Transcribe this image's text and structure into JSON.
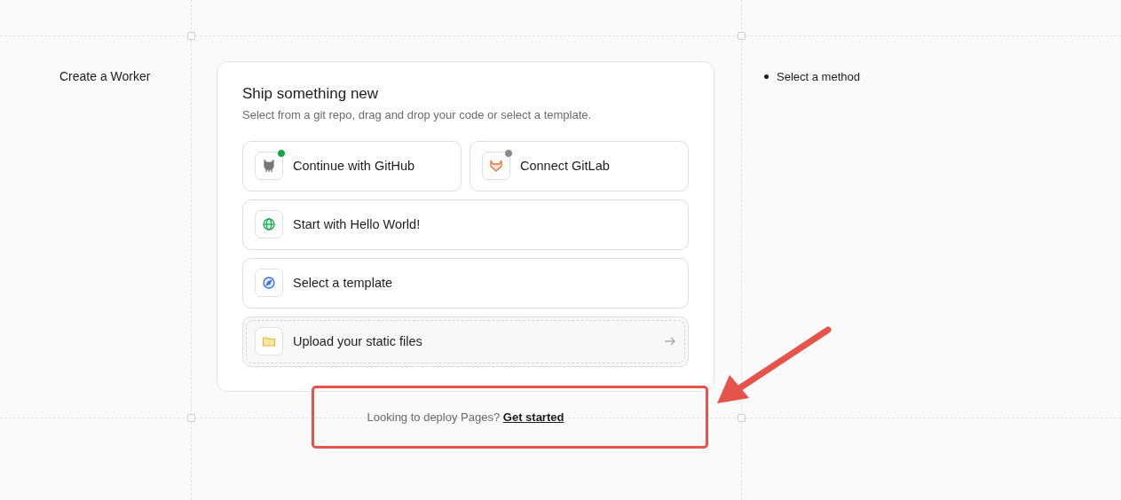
{
  "sidebar": {
    "title": "Create a Worker"
  },
  "card": {
    "title": "Ship something new",
    "subtitle": "Select from a git repo, drag and drop your code or select a template.",
    "options": [
      {
        "kind": "github",
        "label": "Continue with GitHub",
        "color": "#16a34a"
      },
      {
        "kind": "gitlab",
        "label": "Connect GitLab",
        "color": "#8a8a8a"
      },
      {
        "kind": "hello",
        "label": "Start with Hello World!"
      },
      {
        "kind": "template",
        "label": "Select a template"
      },
      {
        "kind": "upload",
        "label": "Upload your static files"
      }
    ]
  },
  "footer": {
    "text": "Looking to deploy Pages?",
    "link": "Get started"
  },
  "steps": [
    {
      "label": "Select a method",
      "selected": true
    }
  ],
  "annotation": {
    "kind": "callout"
  }
}
